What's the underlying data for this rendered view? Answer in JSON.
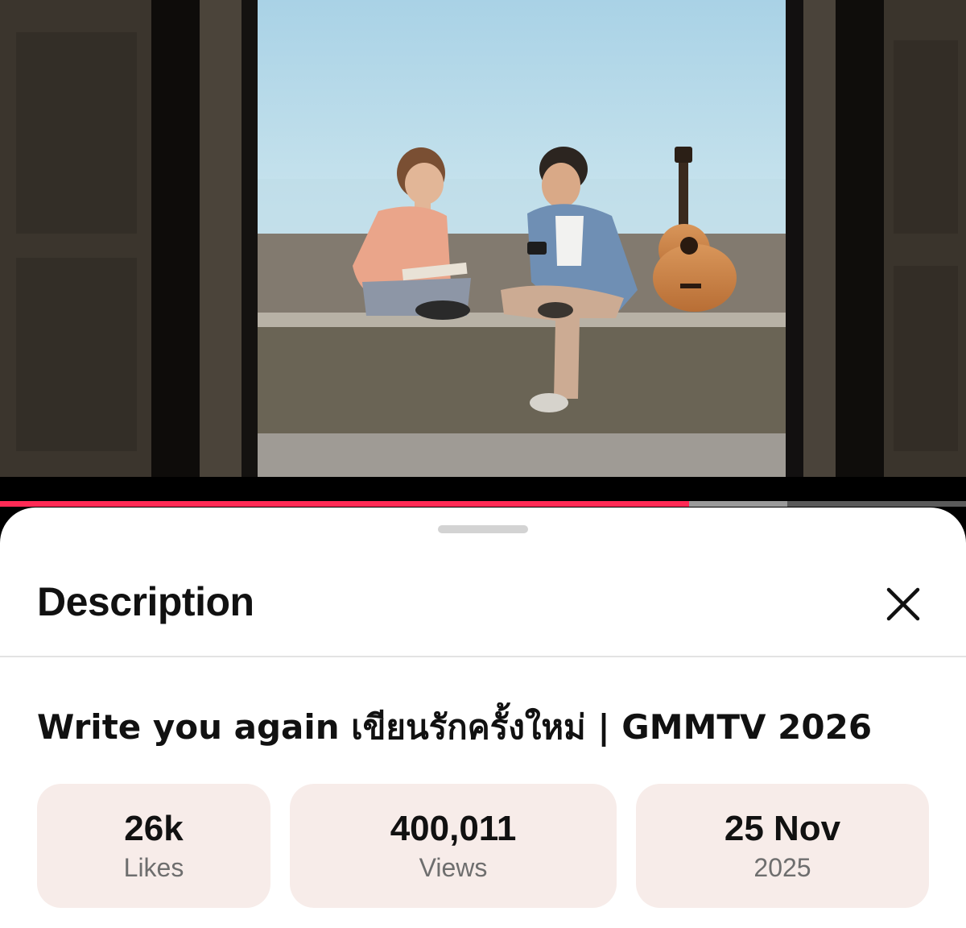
{
  "video": {
    "scene_icon": "video-frame-two-people-guitar-seawall",
    "progress_fraction": 0.713,
    "buffered_fraction": 0.815,
    "colors": {
      "played": "#ff2a55",
      "buffered": "#9a9a9a",
      "track": "#5a5a5a"
    }
  },
  "sheet": {
    "title": "Description",
    "close_icon": "close-icon",
    "video_title": "Write you again เขียนรักครั้งใหม่ | GMMTV 2026",
    "stats": [
      {
        "value": "26k",
        "label": "Likes"
      },
      {
        "value": "400,011",
        "label": "Views"
      },
      {
        "value": "25 Nov",
        "label": "2025"
      }
    ],
    "stat_background": "#f7ece9"
  }
}
